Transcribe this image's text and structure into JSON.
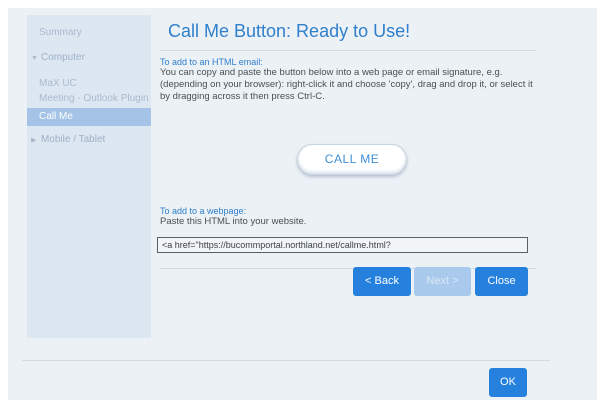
{
  "sidebar": {
    "items": [
      {
        "label": "Summary",
        "type": "item",
        "active": false
      },
      {
        "label": "Computer",
        "type": "group",
        "caret": "▼"
      },
      {
        "label": "MaX UC",
        "type": "item",
        "active": false
      },
      {
        "label": "Meeting - Outlook Plugin",
        "type": "item",
        "active": false
      },
      {
        "label": "Call Me",
        "type": "item",
        "active": true
      },
      {
        "label": "Mobile / Tablet",
        "type": "group",
        "caret": "▶"
      }
    ]
  },
  "main": {
    "title": "Call Me Button: Ready to Use!",
    "email_section": {
      "heading": "To add to an HTML email:",
      "text": "You can copy and paste the button below into a web page or email signature, e.g. (depending on your browser): right-click it and choose 'copy', drag and drop it, or select it by dragging across it then press Ctrl-C."
    },
    "callme_button_label": "CALL ME",
    "webpage_section": {
      "heading": "To add to a webpage:",
      "text": "Paste this HTML into your website."
    },
    "html_snippet": "<a href=\"https://bucommportal.northland.net/callme.html?"
  },
  "wizard_buttons": {
    "back": "< Back",
    "next": "Next >",
    "close": "Close"
  },
  "footer": {
    "ok": "OK"
  },
  "colors": {
    "accent": "#2680dd",
    "title": "#2f7fcb",
    "disabled": "#a9caec",
    "sidebar_active": "#a5c3e6"
  }
}
